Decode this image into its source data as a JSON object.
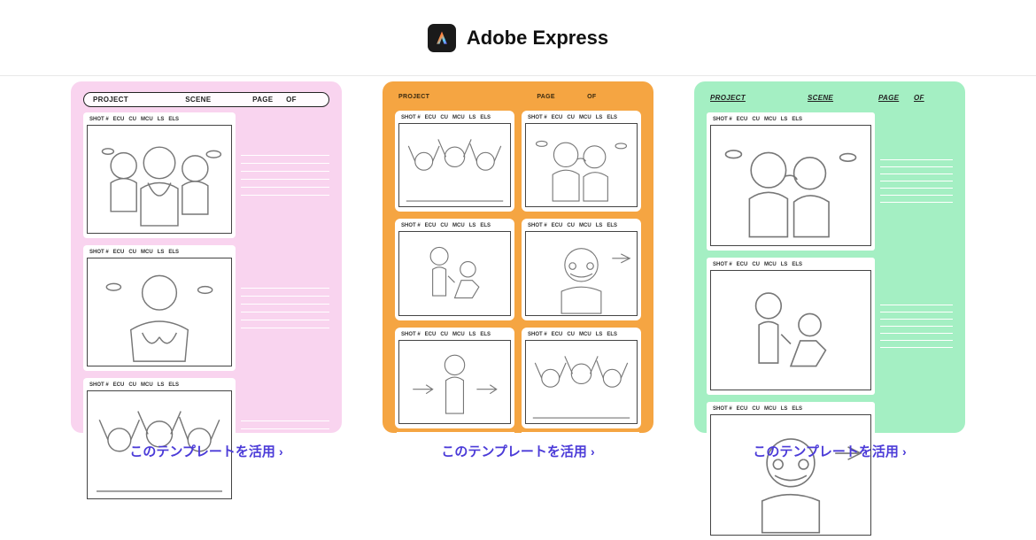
{
  "header": {
    "title": "Adobe Express"
  },
  "storyboard_labels": {
    "project": "PROJECT",
    "scene": "SCENE",
    "page": "PAGE",
    "of": "OF",
    "shot_cols": [
      "SHOT #",
      "ECU",
      "CU",
      "MCU",
      "LS",
      "ELS"
    ]
  },
  "templates": [
    {
      "id": "pink",
      "cta": "このテンプレートを活用"
    },
    {
      "id": "orange",
      "cta": "このテンプレートを活用"
    },
    {
      "id": "green",
      "cta": "このテンプレートを活用"
    }
  ]
}
